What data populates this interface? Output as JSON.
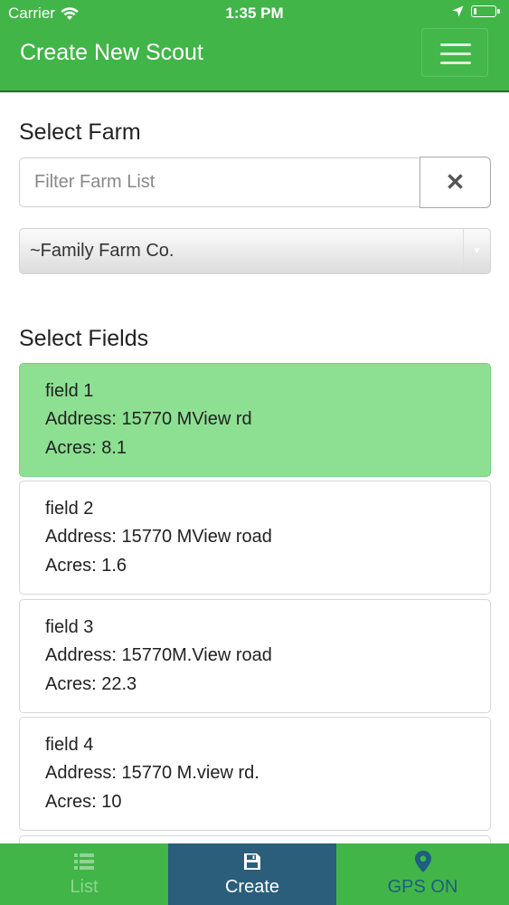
{
  "status_bar": {
    "carrier": "Carrier",
    "time": "1:35 PM",
    "battery_level": 0.15
  },
  "navbar": {
    "title": "Create New Scout",
    "menu_icon": "hamburger-icon"
  },
  "farm": {
    "heading": "Select Farm",
    "filter_placeholder": "Filter Farm List",
    "clear_label": "✕",
    "selected_farm": "~Family Farm Co."
  },
  "fields": {
    "heading": "Select Fields",
    "items": [
      {
        "name": "field 1",
        "address": "Address: 15770 MView rd",
        "acres": "Acres: 8.1",
        "selected": true
      },
      {
        "name": "field 2",
        "address": "Address: 15770 MView road",
        "acres": "Acres: 1.6",
        "selected": false
      },
      {
        "name": "field 3",
        "address": "Address: 15770M.View road",
        "acres": "Acres: 22.3",
        "selected": false
      },
      {
        "name": "field 4",
        "address": "Address: 15770 M.view rd.",
        "acres": "Acres: 10",
        "selected": false
      }
    ]
  },
  "tabs": {
    "list": {
      "label": "List",
      "icon": "list-icon"
    },
    "create": {
      "label": "Create",
      "icon": "save-icon"
    },
    "gps": {
      "label": "GPS ON",
      "icon": "map-marker-icon"
    }
  },
  "colors": {
    "brand_green": "#41b548",
    "selected_card": "#8de092",
    "active_tab": "#2a5e7a"
  }
}
